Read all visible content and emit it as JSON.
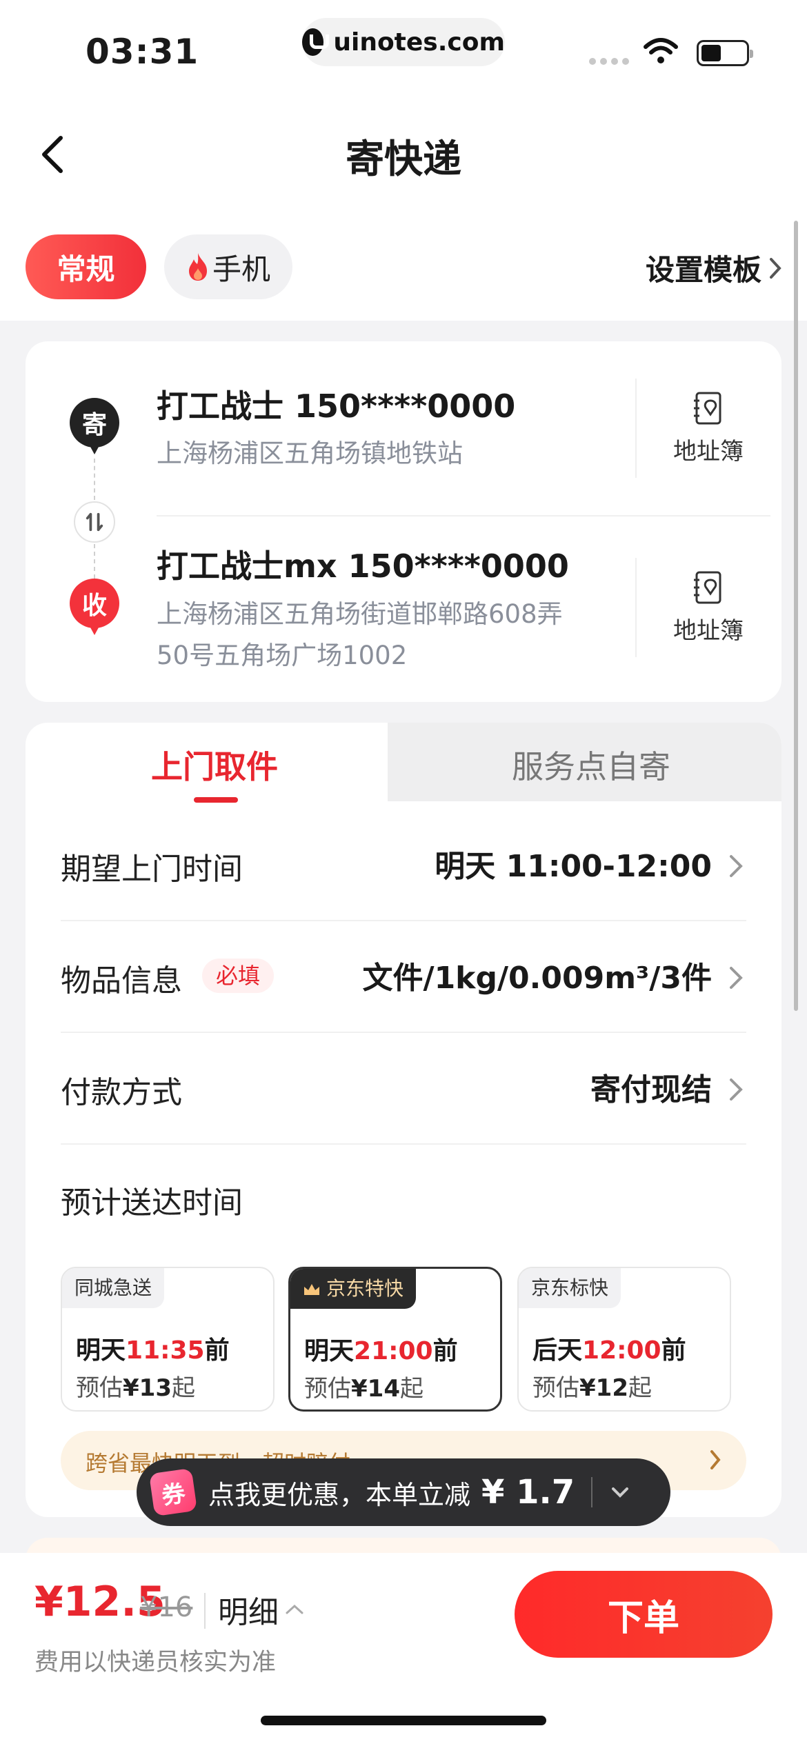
{
  "status_bar": {
    "time": "03:31",
    "url": "uinotes.com"
  },
  "nav": {
    "title": "寄快递"
  },
  "filters": {
    "regular": "常规",
    "phone": "手机",
    "template": "设置模板"
  },
  "sender": {
    "badge": "寄",
    "name": "打工战士  150****0000",
    "address": "上海杨浦区五角场镇地铁站",
    "book": "地址簿"
  },
  "receiver": {
    "badge": "收",
    "name": "打工战士mx  150****0000",
    "address_line1": "上海杨浦区五角场街道邯郸路608弄",
    "address_line2": "50号五角场广场1002",
    "book": "地址簿"
  },
  "tabs": {
    "pickup": "上门取件",
    "self": "服务点自寄"
  },
  "rows": {
    "time": {
      "label": "期望上门时间",
      "value": "明天 11:00-12:00"
    },
    "goods": {
      "label": "物品信息",
      "required": "必填",
      "value": "文件/1kg/0.009m³/3件"
    },
    "payment": {
      "label": "付款方式",
      "value": "寄付现结"
    }
  },
  "estimate": {
    "label": "预计送达时间"
  },
  "options": [
    {
      "tag": "同城急送",
      "eta_prefix": "明天",
      "eta_time": "11:35",
      "eta_suffix": "前",
      "price_prefix": "预估",
      "price": "¥13",
      "price_suffix": "起"
    },
    {
      "tag": "京东特快",
      "eta_prefix": "明天",
      "eta_time": "21:00",
      "eta_suffix": "前",
      "price_prefix": "预估",
      "price": "¥14",
      "price_suffix": "起"
    },
    {
      "tag": "京东标快",
      "eta_prefix": "后天",
      "eta_time": "12:00",
      "eta_suffix": "前",
      "price_prefix": "预估",
      "price": "¥12",
      "price_suffix": "起"
    }
  ],
  "promo_strip": {
    "text": "跨省最快明天到、超时赔付"
  },
  "toast": {
    "icon": "券",
    "text": "点我更优惠，本单立减",
    "amount": "¥ 1.7"
  },
  "bottom": {
    "price": "¥12.5",
    "orig_price": "¥16",
    "detail": "明细",
    "note": "费用以快递员核实为准",
    "order": "下单"
  },
  "colors": {
    "accent": "#e8262f",
    "toast_bg": "#2e2e30"
  }
}
